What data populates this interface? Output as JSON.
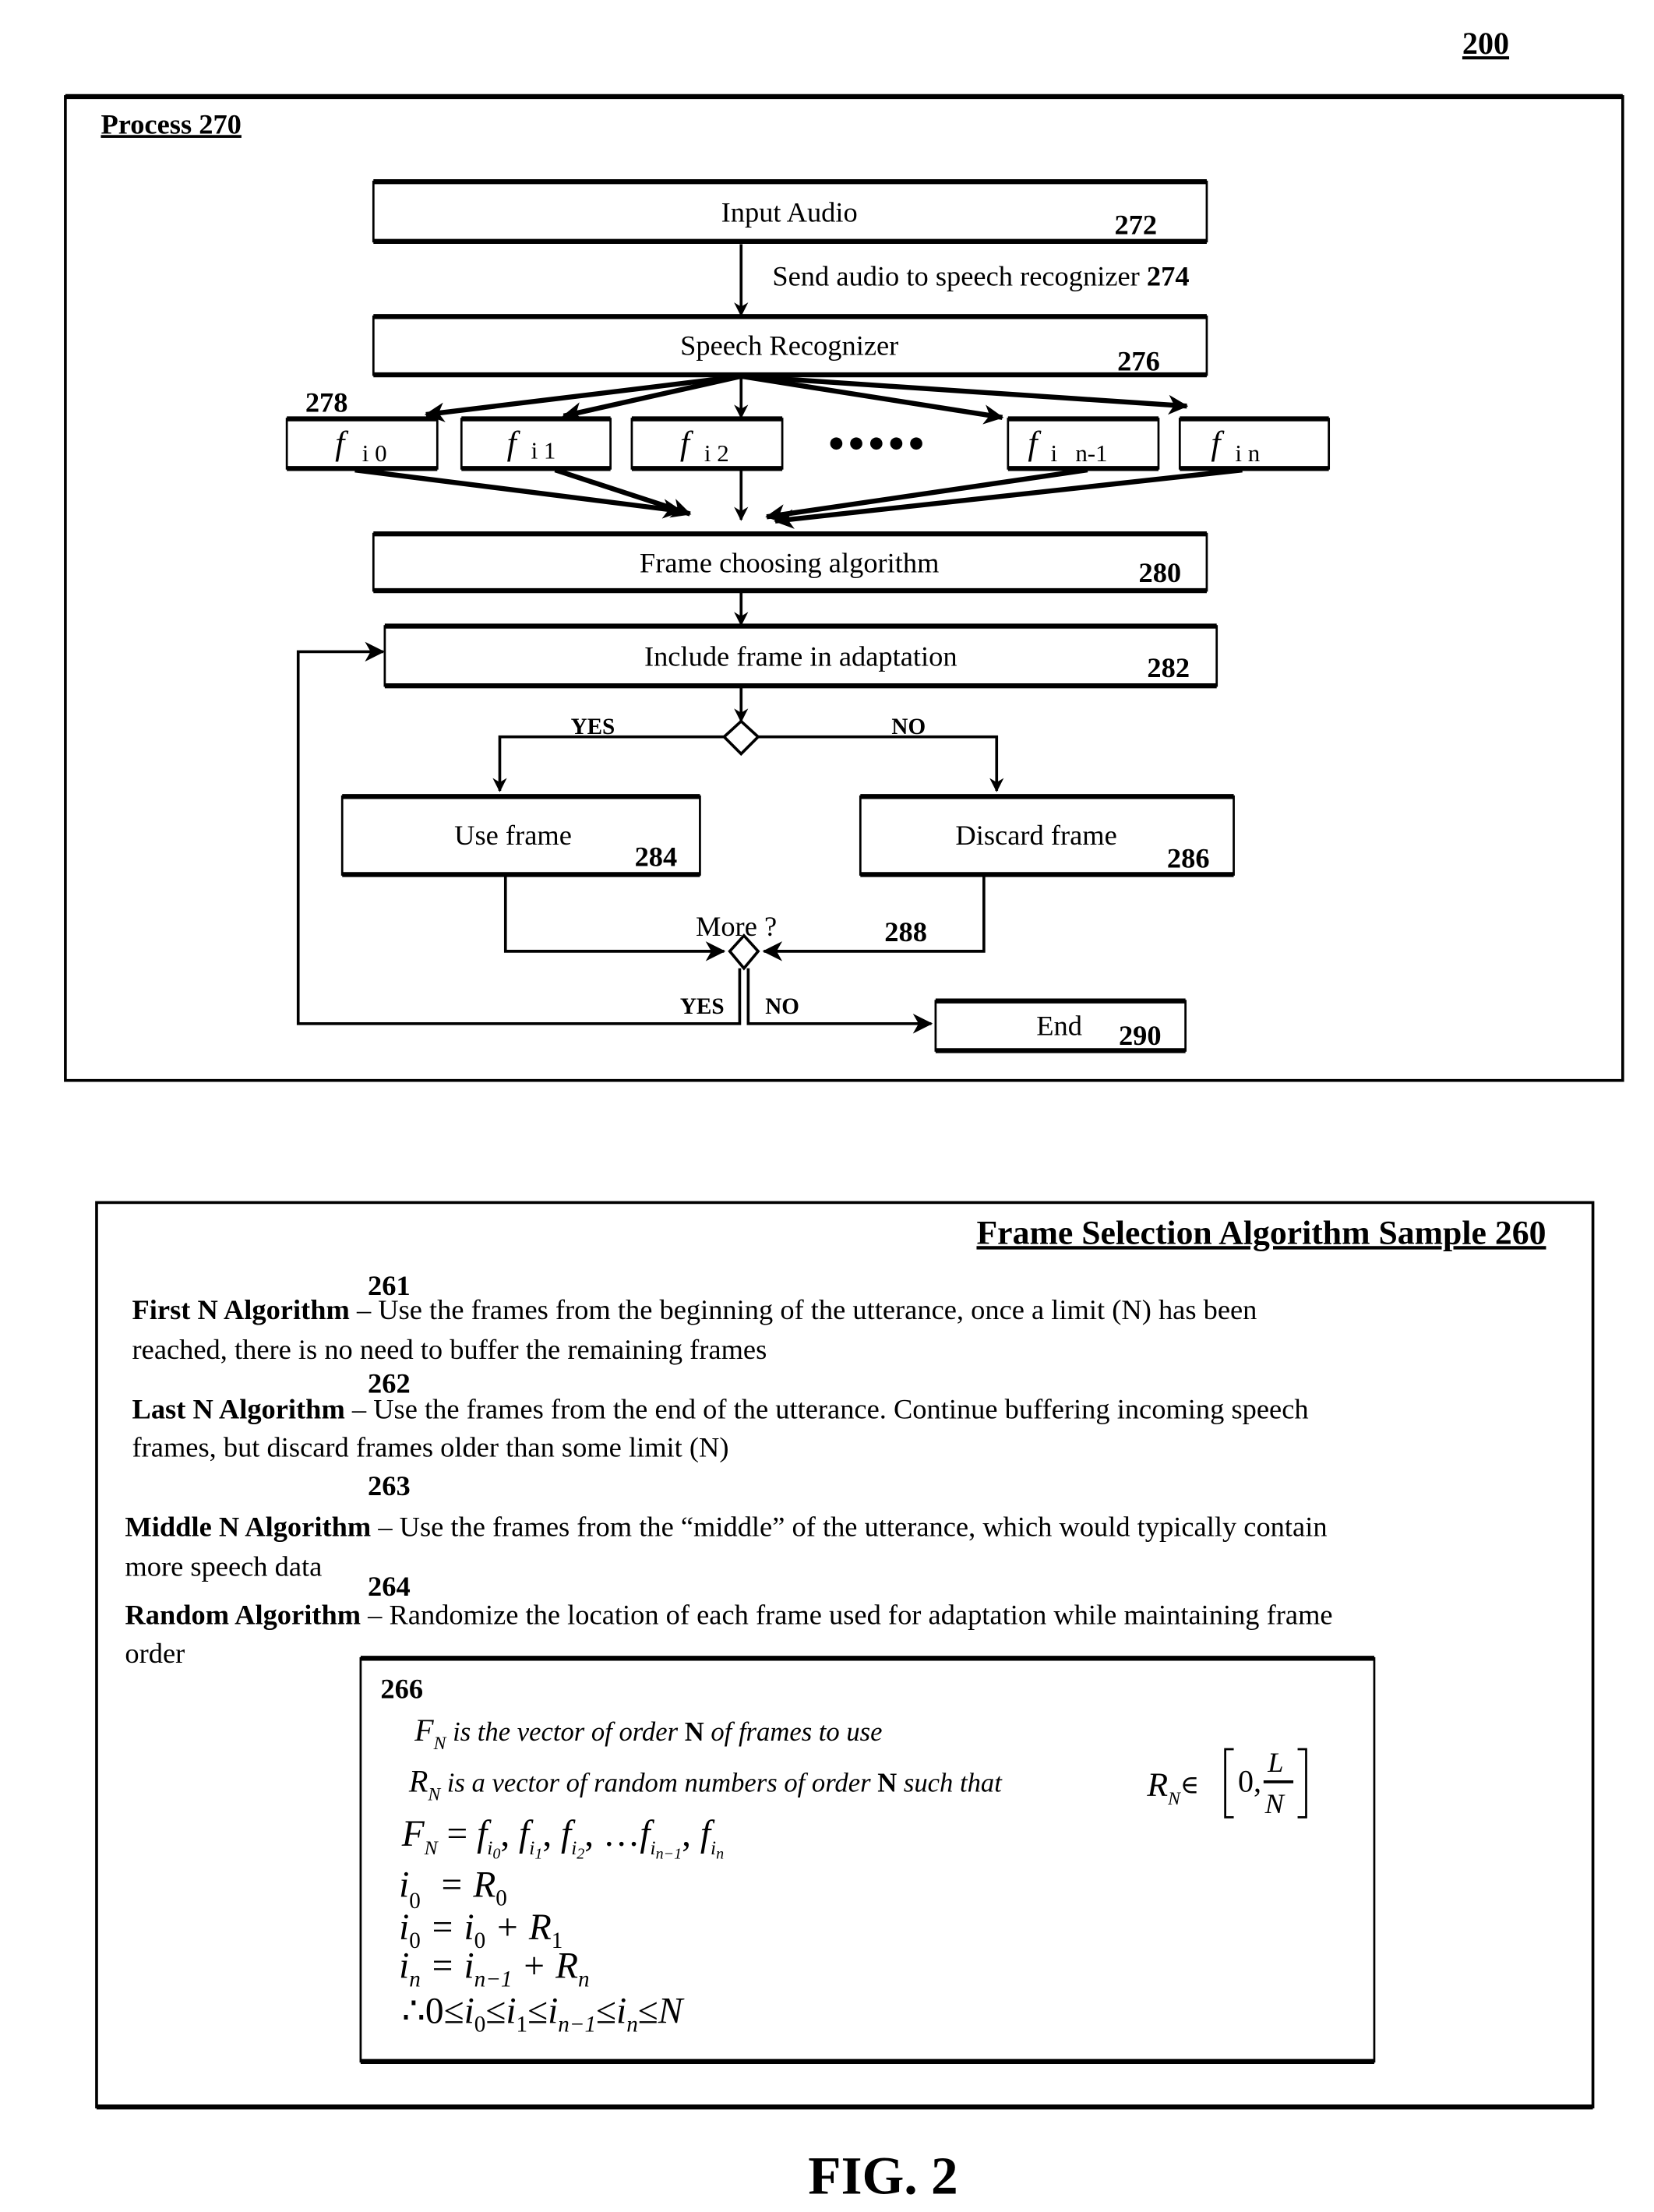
{
  "figure_number": "200",
  "figure_caption": "FIG. 2",
  "process": {
    "title": "Process 270",
    "input_audio": {
      "label": "Input Audio",
      "ref": "272"
    },
    "send_audio": {
      "label": "Send audio to speech recognizer",
      "ref": "274"
    },
    "speech_recognizer": {
      "label": "Speech Recognizer",
      "ref": "276"
    },
    "frames_ref": "278",
    "frames": [
      {
        "f": "f",
        "sub": "i 0"
      },
      {
        "f": "f",
        "sub": "i 1"
      },
      {
        "f": "f",
        "sub": "i 2"
      },
      {
        "f": "f",
        "sub": "i   n-1"
      },
      {
        "f": "f",
        "sub": "i n"
      }
    ],
    "ellipsis": "●●●●●",
    "frame_choosing": {
      "label": "Frame choosing algorithm",
      "ref": "280"
    },
    "include_frame": {
      "label": "Include frame in adaptation",
      "ref": "282"
    },
    "decision1": {
      "yes": "YES",
      "no": "NO"
    },
    "use_frame": {
      "label": "Use frame",
      "ref": "284"
    },
    "discard_frame": {
      "label": "Discard frame",
      "ref": "286"
    },
    "decision2": {
      "label": "More ?",
      "ref": "288",
      "yes": "YES",
      "no": "NO"
    },
    "end": {
      "label": "End",
      "ref": "290"
    }
  },
  "sample": {
    "title": "Frame Selection Algorithm Sample 260",
    "algorithms": [
      {
        "ref": "261",
        "name": "First N Algorithm",
        "line1": " – Use the frames from the beginning of the utterance, once a limit (N) has been",
        "line2": "reached, there is no need to buffer the remaining frames"
      },
      {
        "ref": "262",
        "name": "Last N Algorithm",
        "line1": " – Use the frames from the end of the utterance.  Continue buffering incoming speech",
        "line2": "frames, but discard frames older than some limit (N)"
      },
      {
        "ref": "263",
        "name": "Middle N Algorithm",
        "line1": " – Use the frames from the “middle” of the utterance, which would typically contain",
        "line2": "more speech data"
      },
      {
        "ref": "264",
        "name": "Random Algorithm",
        "line1": " – Randomize the location of each frame used for adaptation while maintaining frame",
        "line2": "order"
      }
    ],
    "formula_box": {
      "ref": "266",
      "def_F": {
        "sym": "F",
        "sub": "N",
        "text": " is the vector of order ",
        "bold": "N",
        "rest": " of frames to use"
      },
      "def_R": {
        "sym": "R",
        "sub": "N",
        "text": " is a vector of random numbers of order ",
        "bold": "N",
        "rest": " such that ",
        "set_sym": "R",
        "set_sub": "N",
        "in": "∈",
        "zero": "0,",
        "num": "L",
        "den": "N"
      },
      "eq1": {
        "lhs": "F",
        "lhs_sub": "N",
        "eq": " = ",
        "terms": [
          "f",
          "f",
          "f",
          "f",
          "f"
        ],
        "subs": [
          "i",
          "i",
          "i",
          "i",
          "i"
        ],
        "subsubs": [
          "0",
          "1",
          "2",
          "n−1",
          "n"
        ],
        "sep": ",",
        "dots": "…"
      },
      "eq2": {
        "text": "i",
        "sub": "0",
        "rhs": "  = R",
        "rhs_sub": "0"
      },
      "eq3": {
        "text": "i",
        "sub": "0",
        "rhs": " = i",
        "rhs_sub": "0",
        "plus": " + R",
        "plus_sub": "1"
      },
      "eq4": {
        "text": "i",
        "sub": "n",
        "rhs": " = i",
        "rhs_sub": "n−1",
        "plus": " + R",
        "plus_sub": "n"
      },
      "eq5": {
        "therefore": "∴",
        "zero": "0",
        "le": "≤",
        "i0": "i",
        "s0": "0",
        "i1": "i",
        "s1": "1",
        "in1": "i",
        "sn1": "n−1",
        "in": "i",
        "sn": "n",
        "N": "N"
      }
    }
  }
}
